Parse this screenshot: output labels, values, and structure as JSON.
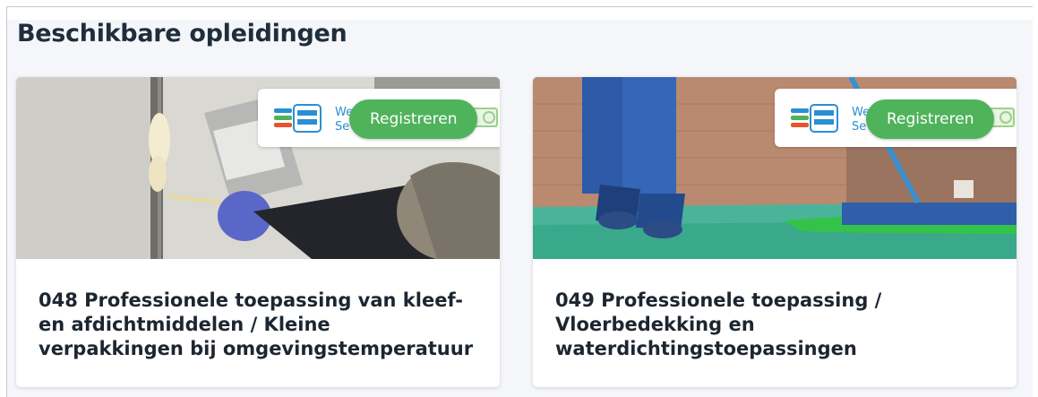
{
  "section": {
    "title": "Beschikbare opleidingen"
  },
  "cards": [
    {
      "register_label": "Registreren",
      "logo_text": [
        "We",
        "Se"
      ],
      "title_lines": [
        "048 Professionele toepassing van kleef-",
        "en afdichtmiddelen / Kleine",
        "verpakkingen bij omgevingstemperatuur"
      ]
    },
    {
      "register_label": "Registreren",
      "logo_text": [
        "We",
        "Se"
      ],
      "title_lines": [
        "049 Professionele toepassing /",
        "Vloerbedekking en",
        "waterdichtingstoepassingen"
      ]
    }
  ],
  "colors": {
    "button": "#4fb35c",
    "title": "#1f2d3d",
    "logo_blue": "#2a8fd4"
  },
  "icons": [
    "safe-use-logo-icon",
    "certificate-icon"
  ]
}
